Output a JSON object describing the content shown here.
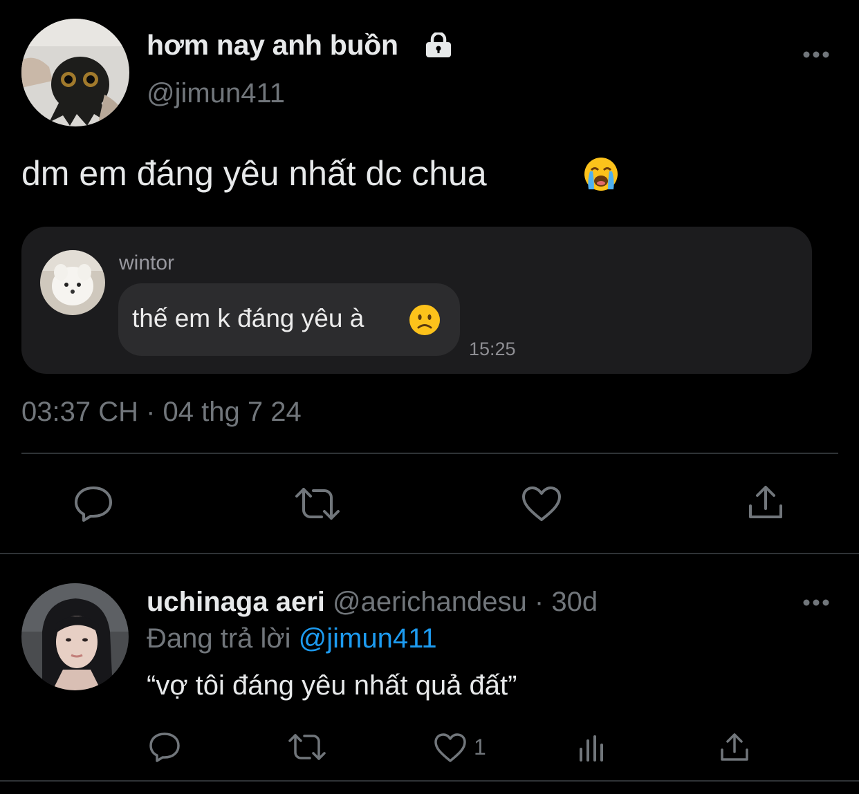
{
  "tweet": {
    "display_name": "hơm nay anh buồn",
    "handle": "@jimun411",
    "text": "dm em đáng yêu nhất dc chua",
    "text_emoji": "loudly-crying-face",
    "timestamp": "03:37 CH · 04 thg 7 24",
    "quote": {
      "sender": "wintor",
      "message": "thế em k đáng yêu à",
      "message_emoji": "slightly-frowning-face",
      "time": "15:25"
    },
    "actions": [
      "reply-icon",
      "retweet-icon",
      "like-icon",
      "share-icon"
    ]
  },
  "reply": {
    "display_name": "uchinaga aeri",
    "handle": "@aerichandesu",
    "age": "· 30d",
    "replying_label": "Đang trả lời",
    "replying_to": "@jimun411",
    "text": "“vợ tôi đáng yêu nhất quả đất”",
    "like_count": "1",
    "actions": [
      "reply-icon",
      "retweet-icon",
      "like-icon",
      "analytics-icon",
      "share-icon"
    ]
  },
  "colors": {
    "background": "#000000",
    "text_primary": "#e7e9ea",
    "text_secondary": "#71767b",
    "link": "#1d9bf0",
    "divider": "#2f3336",
    "quote_card": "#1c1c1e",
    "quote_bubble": "#2c2c2e"
  }
}
